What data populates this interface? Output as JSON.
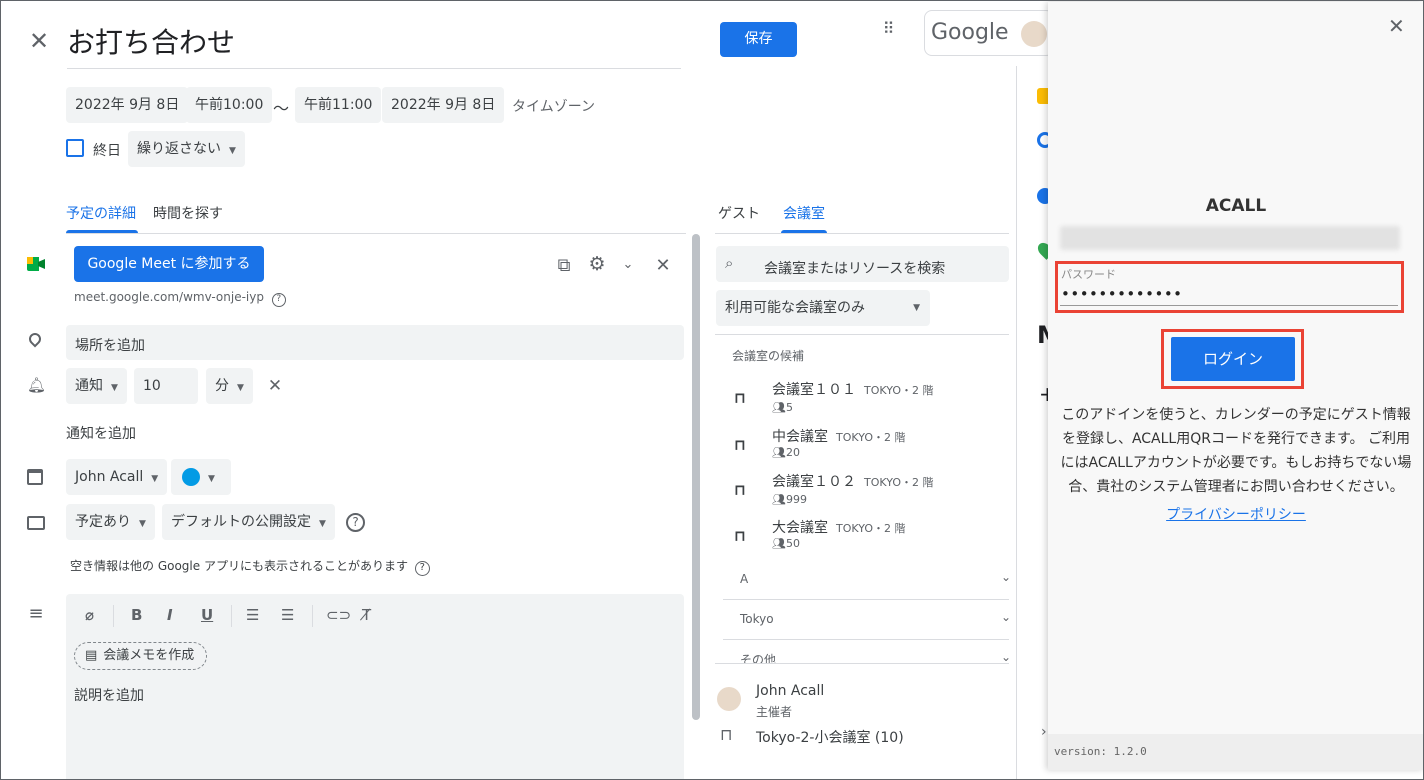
{
  "event": {
    "title": "お打ち合わせ",
    "start_date": "2022年 9月 8日",
    "start_time": "午前10:00",
    "tilde": "〜",
    "end_time": "午前11:00",
    "end_date": "2022年 9月 8日",
    "timezone": "タイムゾーン",
    "all_day": "終日",
    "repeat": "繰り返さない",
    "save": "保存"
  },
  "header": {
    "google": "Google"
  },
  "tabs": {
    "details": "予定の詳細",
    "find_time": "時間を探す"
  },
  "meet": {
    "join": "Google Meet に参加する",
    "link": "meet.google.com/wmv-onje-iyp"
  },
  "location_placeholder": "場所を追加",
  "notification": {
    "type": "通知",
    "value": "10",
    "unit": "分",
    "add": "通知を追加"
  },
  "calendar": {
    "owner": "John Acall",
    "color": "#039be5"
  },
  "availability": {
    "status": "予定あり",
    "visibility": "デフォルトの公開設定",
    "note": "空き情報は他の Google アプリにも表示されることがあります"
  },
  "description": {
    "meeting_notes": "会議メモを作成",
    "placeholder": "説明を追加"
  },
  "right_tabs": {
    "guests": "ゲスト",
    "rooms": "会議室"
  },
  "rooms": {
    "search_placeholder": "会議室またはリソースを検索",
    "filter": "利用可能な会議室のみ",
    "candidates_label": "会議室の候補",
    "items": [
      {
        "name": "会議室１０１",
        "location": "TOKYO・2 階",
        "capacity": "5"
      },
      {
        "name": "中会議室",
        "location": "TOKYO・2 階",
        "capacity": "20"
      },
      {
        "name": "会議室１０２",
        "location": "TOKYO・2 階",
        "capacity": "999"
      },
      {
        "name": "大会議室",
        "location": "TOKYO・2 階",
        "capacity": "50"
      }
    ],
    "groups": [
      "A",
      "Tokyo",
      "その他"
    ]
  },
  "attendees": [
    {
      "name": "John Acall",
      "role": "主催者"
    },
    {
      "name": "Tokyo-2-小会議室 (10)",
      "role": ""
    }
  ],
  "acall": {
    "title": "ACALL",
    "password_label": "パスワード",
    "password_value": "•••••••••••••",
    "login": "ログイン",
    "description": "このアドインを使うと、カレンダーの予定にゲスト情報を登録し、ACALL用QRコードを発行できます。 ご利用にはACALLアカウントが必要です。もしお持ちでない場合、貴社のシステム管理者にお問い合わせください。",
    "privacy": "プライバシーポリシー",
    "version": "version: 1.2.0",
    "highlight_color": "#ea4335",
    "brand_color": "#1a73e8"
  }
}
